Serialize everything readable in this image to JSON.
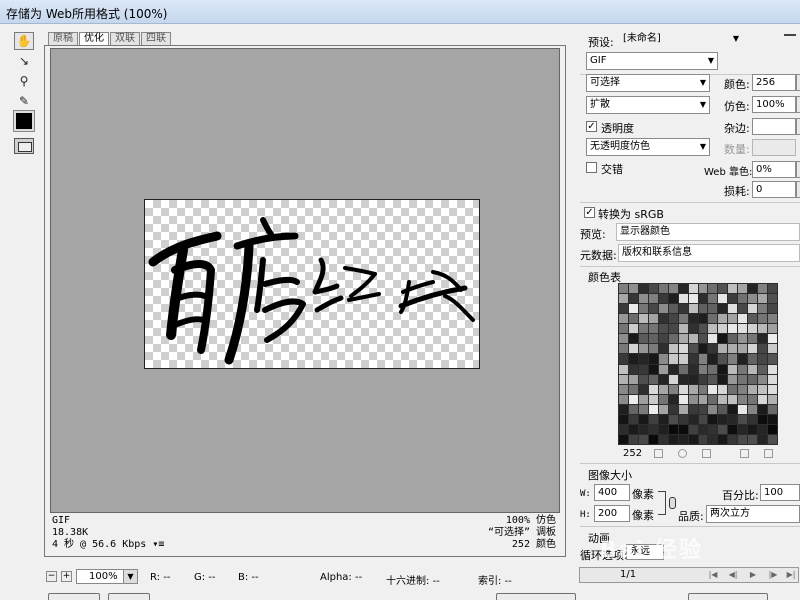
{
  "window": {
    "title": "存储为 Web所用格式 (100%)"
  },
  "tools": [
    {
      "name": "hand-tool-icon",
      "glyph": "✋"
    },
    {
      "name": "slice-select-tool-icon",
      "glyph": "↗"
    },
    {
      "name": "zoom-tool-icon",
      "glyph": "🔍"
    },
    {
      "name": "eyedropper-tool-icon",
      "glyph": "✎"
    }
  ],
  "tabs": [
    "原稿",
    "优化",
    "双联",
    "四联"
  ],
  "active_tab": "优化",
  "preview_info": {
    "format": "GIF",
    "size": "18.38K",
    "download_time": "4 秒 @ 56.6 Kbps",
    "dither": "100% 仿色",
    "palette": "“可选择” 调板",
    "colors": "252 颜色"
  },
  "status_bar": {
    "zoom": "100%",
    "r": "R: --",
    "g": "G: --",
    "b": "B: --",
    "alpha": "Alpha: --",
    "hex": "十六进制: --",
    "index": "索引: --"
  },
  "settings": {
    "preset_label": "预设:",
    "preset_value": "[未命名]",
    "format": "GIF",
    "reduction": "可选择",
    "dither_algorithm": "扩散",
    "transparency_label": "透明度",
    "transparency_checked": true,
    "transparency_dither": "无透明度仿色",
    "interlaced_label": "交错",
    "interlaced_checked": false,
    "colors_label": "颜色:",
    "colors_value": "256",
    "dither_label": "仿色:",
    "dither_value": "100%",
    "matte_label": "杂边:",
    "matte_value": "",
    "amount_label": "数量:",
    "amount_value": "",
    "web_snap_label": "Web 靠色:",
    "web_snap_value": "0%",
    "lossy_label": "损耗:",
    "lossy_value": "0",
    "convert_srgb_label": "转换为 sRGB",
    "convert_srgb_checked": true,
    "preview_label": "预览:",
    "preview_value": "显示器颜色",
    "metadata_label": "元数据:",
    "metadata_value": "版权和联系信息"
  },
  "color_table": {
    "title": "颜色表",
    "count": "252"
  },
  "image_size": {
    "title": "图像大小",
    "w_label": "W:",
    "w_value": "400",
    "h_label": "H:",
    "h_value": "200",
    "unit": "像素",
    "percent_label": "百分比:",
    "percent_value": "100",
    "quality_label": "品质:",
    "quality_value": "两次立方"
  },
  "animation": {
    "title": "动画",
    "loop_label": "循环选项:",
    "loop_value": "永远",
    "frame_counter": "1/1"
  },
  "watermark": "Bai 经验",
  "colors": {
    "canvas_bg": "#a5a5a5",
    "panel_bg": "#f0f0f0"
  }
}
